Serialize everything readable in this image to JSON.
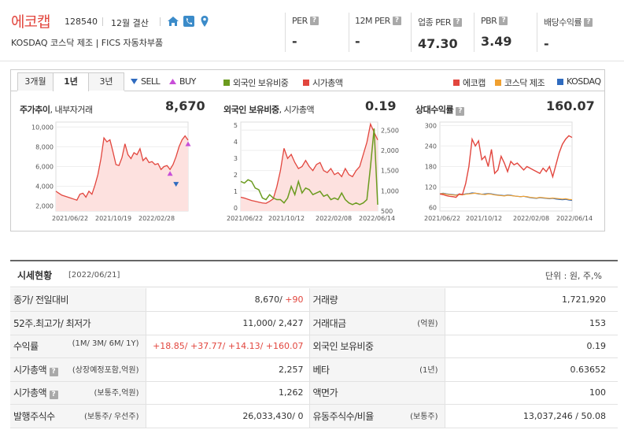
{
  "company": {
    "name": "에코캡",
    "code": "128540",
    "fiscal": "12월 결산",
    "market_line": "KOSDAQ  코스닥 제조  |  FICS 자동차부품"
  },
  "metrics": [
    {
      "label": "PER",
      "value": "-"
    },
    {
      "label": "12M PER",
      "value": "-"
    },
    {
      "label": "업종 PER",
      "value": "47.30"
    },
    {
      "label": "PBR",
      "value": "3.49"
    },
    {
      "label": "배당수익률",
      "value": "-"
    }
  ],
  "tabs": [
    "3개월",
    "1년",
    "3년"
  ],
  "active_tab": "1년",
  "legend": {
    "sell": "SELL",
    "buy": "BUY",
    "foreign": "외국인 보유비중",
    "mcap": "시가총액",
    "company": "에코캡",
    "sector": "코스닥 제조",
    "index": "KOSDAQ"
  },
  "colors": {
    "brand": "#e2463e",
    "price_line": "#e2463e",
    "foreign_line": "#6b9b1f",
    "sector_line": "#f0a030",
    "index_line": "#2f6bbf",
    "sell_marker": "#2f6bbf",
    "buy_marker": "#c84fd8"
  },
  "panels": {
    "price": {
      "title": "주가추이",
      "subtitle": ", 내부자거래",
      "value": "8,670"
    },
    "foreign": {
      "title": "외국인 보유비중",
      "subtitle": ", 시가총액",
      "value": "0.19"
    },
    "relative": {
      "title": "상대수익률",
      "value": "160.07"
    }
  },
  "chart_data": [
    {
      "type": "area",
      "name": "price",
      "x": [
        "2021/06/22",
        "2021/10/19",
        "2022/02/28"
      ],
      "yticks": [
        "10,000",
        "8,000",
        "6,000",
        "4,000",
        "2,000"
      ],
      "ylim": [
        1500,
        10500
      ],
      "series": [
        {
          "values": [
            3500,
            3300,
            3100,
            3000,
            2900,
            2800,
            2700,
            2600,
            3200,
            3300,
            2900,
            3500,
            3200,
            4100,
            5200,
            6800,
            8900,
            8500,
            8700,
            7500,
            6200,
            6100,
            6900,
            8300,
            7200,
            6800,
            7400,
            7200,
            7800,
            6600,
            6900,
            6400,
            6500,
            6200,
            6300,
            5700,
            6000,
            6100,
            5700,
            6200,
            7000,
            8000,
            8700,
            9100,
            8670
          ]
        }
      ],
      "markers": [
        {
          "type": "sell",
          "x_index": 40,
          "value": 4200
        },
        {
          "type": "buy",
          "x_index": 38,
          "value": 5300
        },
        {
          "type": "buy",
          "x_index": 44,
          "value": 8300
        }
      ]
    },
    {
      "type": "line",
      "name": "foreign",
      "x": [
        "2021/06/22",
        "2021/10/12",
        "2022/02/08",
        "2022/06/14"
      ],
      "yticks_left": [
        "5",
        "4",
        "3",
        "2",
        "1",
        "0"
      ],
      "yticks_right": [
        "2,500",
        "2,000",
        "1,500",
        "1,000",
        "500"
      ],
      "series": [
        {
          "name": "외국인 보유비중",
          "values": [
            1.6,
            1.5,
            1.7,
            1.6,
            1.2,
            1.1,
            0.6,
            0.5,
            0.8,
            0.6,
            0.5,
            0.5,
            0.3,
            0.6,
            1.3,
            0.8,
            1.6,
            0.9,
            1.2,
            1.1,
            0.8,
            0.9,
            1.0,
            0.7,
            0.8,
            0.5,
            0.6,
            0.5,
            0.9,
            0.5,
            0.3,
            0.2,
            0.3,
            0.2,
            0.3,
            0.5,
            2.5,
            4.8,
            0.19
          ]
        },
        {
          "name": "시가총액",
          "values": [
            840,
            820,
            790,
            760,
            740,
            720,
            700,
            690,
            740,
            800,
            1100,
            1500,
            2050,
            1800,
            1900,
            1700,
            1550,
            1600,
            1750,
            1600,
            1500,
            1650,
            1700,
            1500,
            1450,
            1550,
            1400,
            1450,
            1350,
            1550,
            1400,
            1350,
            1500,
            1600,
            1900,
            2200,
            2650,
            2450,
            2257
          ]
        }
      ]
    },
    {
      "type": "line",
      "name": "relative",
      "x": [
        "2021/06/22",
        "2021/10/12",
        "2022/02/08",
        "2022/06/14"
      ],
      "yticks": [
        "300",
        "240",
        "180",
        "120",
        "60"
      ],
      "ylim": [
        50,
        310
      ],
      "series": [
        {
          "name": "에코캡",
          "values": [
            100,
            98,
            95,
            93,
            92,
            90,
            100,
            98,
            130,
            180,
            260,
            240,
            255,
            200,
            210,
            180,
            230,
            160,
            170,
            210,
            190,
            165,
            195,
            185,
            190,
            180,
            170,
            180,
            175,
            170,
            165,
            160,
            175,
            165,
            180,
            150,
            185,
            220,
            245,
            260,
            270,
            265
          ]
        },
        {
          "name": "코스닥 제조",
          "values": [
            100,
            101,
            99,
            98,
            97,
            96,
            98,
            97,
            99,
            100,
            101,
            102,
            101,
            99,
            98,
            100,
            99,
            97,
            96,
            95,
            94,
            96,
            95,
            94,
            93,
            92,
            93,
            92,
            90,
            89,
            88,
            90,
            89,
            88,
            87,
            88,
            87,
            86,
            85,
            86,
            84,
            83
          ]
        },
        {
          "name": "KOSDAQ",
          "values": [
            100,
            102,
            100,
            99,
            98,
            97,
            99,
            98,
            100,
            101,
            103,
            102,
            100,
            99,
            100,
            101,
            100,
            98,
            97,
            96,
            95,
            97,
            96,
            94,
            93,
            92,
            93,
            91,
            89,
            88,
            87,
            89,
            88,
            87,
            86,
            87,
            85,
            84,
            83,
            84,
            82,
            81
          ]
        }
      ]
    }
  ],
  "section": {
    "title": "시세현황",
    "date": "[2022/06/21]",
    "unit": "단위 : 원, 주,%"
  },
  "table": {
    "rows": [
      {
        "l1": "종가/ 전일대비",
        "l1sub": "",
        "v1a": "8,670/",
        "v1b": " +90",
        "l2": "거래량",
        "l2sub": "",
        "v2": "1,721,920"
      },
      {
        "l1": "52주.최고가/ 최저가",
        "l1sub": "",
        "v1a": "11,000/ 2,427",
        "v1b": "",
        "l2": "거래대금",
        "l2sub": "(억원)",
        "v2": "153"
      },
      {
        "l1": "수익률",
        "l1sub": "(1M/ 3M/ 6M/ 1Y)",
        "v1a": "",
        "v1b": "+18.85/ +37.77/ +14.13/ +160.07",
        "l2": "외국인 보유비중",
        "l2sub": "",
        "v2": "0.19"
      },
      {
        "l1": "시가총액",
        "l1sub": "(상장예정포함,억원)",
        "v1a": "2,257",
        "v1b": "",
        "l2": "베타",
        "l2sub": "(1년)",
        "v2": "0.63652"
      },
      {
        "l1": "시가총액",
        "l1sub": "(보통주,억원)",
        "v1a": "1,262",
        "v1b": "",
        "l2": "액면가",
        "l2sub": "",
        "v2": "100"
      },
      {
        "l1": "발행주식수",
        "l1sub": "(보통주/ 우선주)",
        "v1a": "26,033,430/ 0",
        "v1b": "",
        "l2": "유동주식수/비율",
        "l2sub": "(보통주)",
        "v2": "13,037,246 / 50.08"
      }
    ]
  }
}
